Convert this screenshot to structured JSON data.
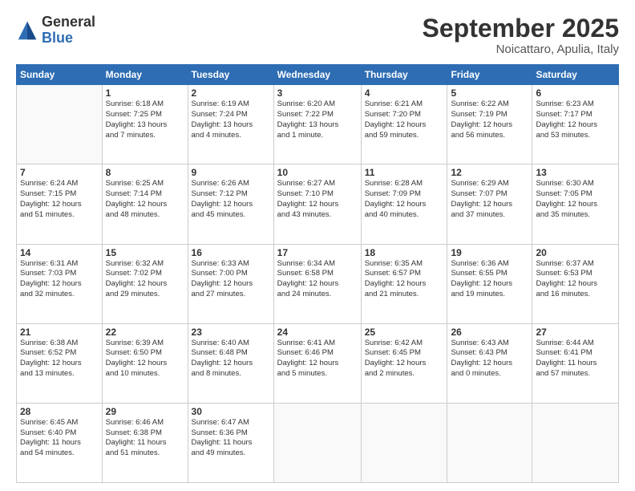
{
  "logo": {
    "general": "General",
    "blue": "Blue"
  },
  "header": {
    "month": "September 2025",
    "location": "Noicattaro, Apulia, Italy"
  },
  "weekdays": [
    "Sunday",
    "Monday",
    "Tuesday",
    "Wednesday",
    "Thursday",
    "Friday",
    "Saturday"
  ],
  "weeks": [
    [
      {
        "day": "",
        "info": []
      },
      {
        "day": "1",
        "info": [
          "Sunrise: 6:18 AM",
          "Sunset: 7:25 PM",
          "Daylight: 13 hours",
          "and 7 minutes."
        ]
      },
      {
        "day": "2",
        "info": [
          "Sunrise: 6:19 AM",
          "Sunset: 7:24 PM",
          "Daylight: 13 hours",
          "and 4 minutes."
        ]
      },
      {
        "day": "3",
        "info": [
          "Sunrise: 6:20 AM",
          "Sunset: 7:22 PM",
          "Daylight: 13 hours",
          "and 1 minute."
        ]
      },
      {
        "day": "4",
        "info": [
          "Sunrise: 6:21 AM",
          "Sunset: 7:20 PM",
          "Daylight: 12 hours",
          "and 59 minutes."
        ]
      },
      {
        "day": "5",
        "info": [
          "Sunrise: 6:22 AM",
          "Sunset: 7:19 PM",
          "Daylight: 12 hours",
          "and 56 minutes."
        ]
      },
      {
        "day": "6",
        "info": [
          "Sunrise: 6:23 AM",
          "Sunset: 7:17 PM",
          "Daylight: 12 hours",
          "and 53 minutes."
        ]
      }
    ],
    [
      {
        "day": "7",
        "info": [
          "Sunrise: 6:24 AM",
          "Sunset: 7:15 PM",
          "Daylight: 12 hours",
          "and 51 minutes."
        ]
      },
      {
        "day": "8",
        "info": [
          "Sunrise: 6:25 AM",
          "Sunset: 7:14 PM",
          "Daylight: 12 hours",
          "and 48 minutes."
        ]
      },
      {
        "day": "9",
        "info": [
          "Sunrise: 6:26 AM",
          "Sunset: 7:12 PM",
          "Daylight: 12 hours",
          "and 45 minutes."
        ]
      },
      {
        "day": "10",
        "info": [
          "Sunrise: 6:27 AM",
          "Sunset: 7:10 PM",
          "Daylight: 12 hours",
          "and 43 minutes."
        ]
      },
      {
        "day": "11",
        "info": [
          "Sunrise: 6:28 AM",
          "Sunset: 7:09 PM",
          "Daylight: 12 hours",
          "and 40 minutes."
        ]
      },
      {
        "day": "12",
        "info": [
          "Sunrise: 6:29 AM",
          "Sunset: 7:07 PM",
          "Daylight: 12 hours",
          "and 37 minutes."
        ]
      },
      {
        "day": "13",
        "info": [
          "Sunrise: 6:30 AM",
          "Sunset: 7:05 PM",
          "Daylight: 12 hours",
          "and 35 minutes."
        ]
      }
    ],
    [
      {
        "day": "14",
        "info": [
          "Sunrise: 6:31 AM",
          "Sunset: 7:03 PM",
          "Daylight: 12 hours",
          "and 32 minutes."
        ]
      },
      {
        "day": "15",
        "info": [
          "Sunrise: 6:32 AM",
          "Sunset: 7:02 PM",
          "Daylight: 12 hours",
          "and 29 minutes."
        ]
      },
      {
        "day": "16",
        "info": [
          "Sunrise: 6:33 AM",
          "Sunset: 7:00 PM",
          "Daylight: 12 hours",
          "and 27 minutes."
        ]
      },
      {
        "day": "17",
        "info": [
          "Sunrise: 6:34 AM",
          "Sunset: 6:58 PM",
          "Daylight: 12 hours",
          "and 24 minutes."
        ]
      },
      {
        "day": "18",
        "info": [
          "Sunrise: 6:35 AM",
          "Sunset: 6:57 PM",
          "Daylight: 12 hours",
          "and 21 minutes."
        ]
      },
      {
        "day": "19",
        "info": [
          "Sunrise: 6:36 AM",
          "Sunset: 6:55 PM",
          "Daylight: 12 hours",
          "and 19 minutes."
        ]
      },
      {
        "day": "20",
        "info": [
          "Sunrise: 6:37 AM",
          "Sunset: 6:53 PM",
          "Daylight: 12 hours",
          "and 16 minutes."
        ]
      }
    ],
    [
      {
        "day": "21",
        "info": [
          "Sunrise: 6:38 AM",
          "Sunset: 6:52 PM",
          "Daylight: 12 hours",
          "and 13 minutes."
        ]
      },
      {
        "day": "22",
        "info": [
          "Sunrise: 6:39 AM",
          "Sunset: 6:50 PM",
          "Daylight: 12 hours",
          "and 10 minutes."
        ]
      },
      {
        "day": "23",
        "info": [
          "Sunrise: 6:40 AM",
          "Sunset: 6:48 PM",
          "Daylight: 12 hours",
          "and 8 minutes."
        ]
      },
      {
        "day": "24",
        "info": [
          "Sunrise: 6:41 AM",
          "Sunset: 6:46 PM",
          "Daylight: 12 hours",
          "and 5 minutes."
        ]
      },
      {
        "day": "25",
        "info": [
          "Sunrise: 6:42 AM",
          "Sunset: 6:45 PM",
          "Daylight: 12 hours",
          "and 2 minutes."
        ]
      },
      {
        "day": "26",
        "info": [
          "Sunrise: 6:43 AM",
          "Sunset: 6:43 PM",
          "Daylight: 12 hours",
          "and 0 minutes."
        ]
      },
      {
        "day": "27",
        "info": [
          "Sunrise: 6:44 AM",
          "Sunset: 6:41 PM",
          "Daylight: 11 hours",
          "and 57 minutes."
        ]
      }
    ],
    [
      {
        "day": "28",
        "info": [
          "Sunrise: 6:45 AM",
          "Sunset: 6:40 PM",
          "Daylight: 11 hours",
          "and 54 minutes."
        ]
      },
      {
        "day": "29",
        "info": [
          "Sunrise: 6:46 AM",
          "Sunset: 6:38 PM",
          "Daylight: 11 hours",
          "and 51 minutes."
        ]
      },
      {
        "day": "30",
        "info": [
          "Sunrise: 6:47 AM",
          "Sunset: 6:36 PM",
          "Daylight: 11 hours",
          "and 49 minutes."
        ]
      },
      {
        "day": "",
        "info": []
      },
      {
        "day": "",
        "info": []
      },
      {
        "day": "",
        "info": []
      },
      {
        "day": "",
        "info": []
      }
    ]
  ]
}
